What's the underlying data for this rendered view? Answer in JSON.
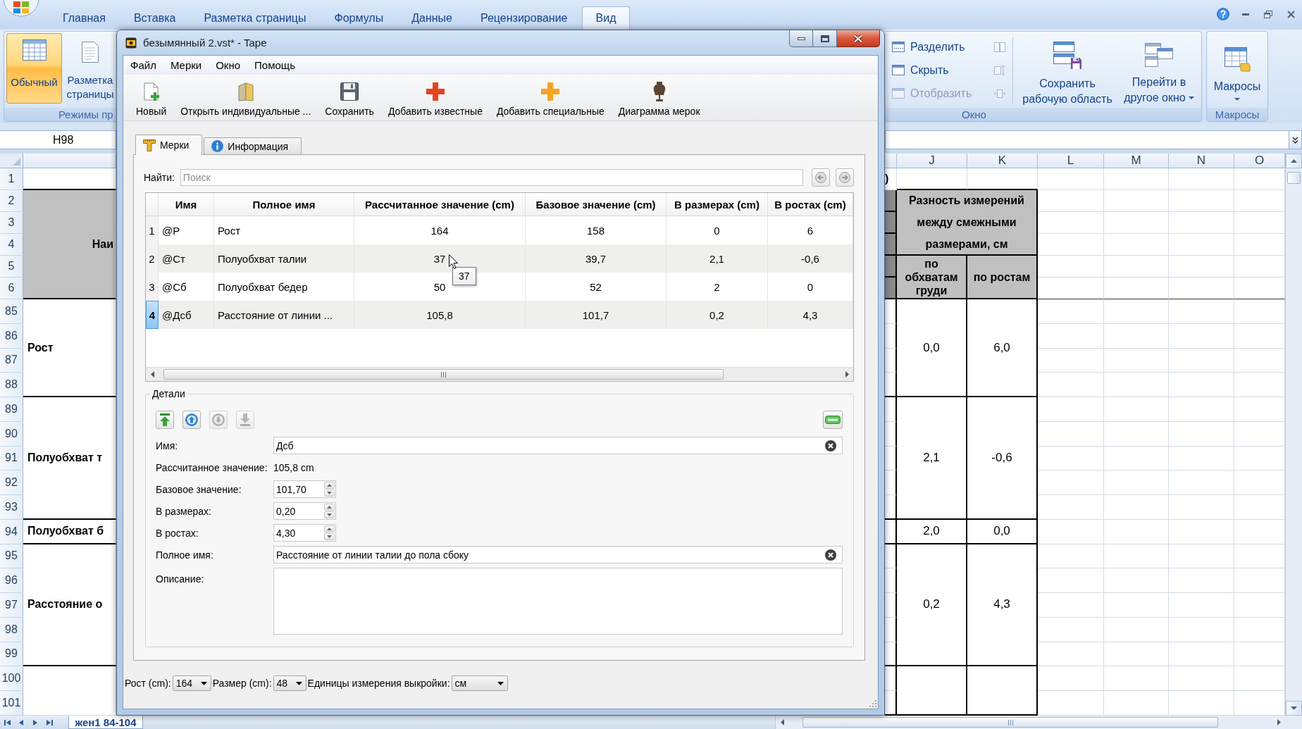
{
  "excel": {
    "ribbon_tabs": [
      {
        "label": "Главная",
        "selected": false
      },
      {
        "label": "Вставка",
        "selected": false
      },
      {
        "label": "Разметка страницы",
        "selected": false
      },
      {
        "label": "Формулы",
        "selected": false
      },
      {
        "label": "Данные",
        "selected": false
      },
      {
        "label": "Рецензирование",
        "selected": false
      },
      {
        "label": "Вид",
        "selected": true
      }
    ],
    "view_group": {
      "label": "Режимы пр",
      "buttons": [
        {
          "label": "Обычный",
          "selected": true
        },
        {
          "label": "Разметка страницы",
          "selected": false
        }
      ]
    },
    "window_group": {
      "label": "Окно",
      "commands": [
        {
          "label": "Разделить",
          "disabled": false
        },
        {
          "label": "Скрыть",
          "disabled": false
        },
        {
          "label": "Отобразить",
          "disabled": true
        }
      ],
      "small_buttons": [
        {
          "disabled": true
        },
        {
          "disabled": true
        },
        {
          "disabled": true
        }
      ],
      "large_buttons": [
        {
          "label": "Сохранить рабочую область",
          "has_menu": false
        },
        {
          "label": "Перейти в другое окно",
          "has_menu": true
        }
      ]
    },
    "macros_group": {
      "label": "Макросы",
      "button": {
        "label": "Макросы",
        "has_menu": true
      }
    },
    "name_box": "H98",
    "columns": [
      "J",
      "K",
      "L",
      "M",
      "N",
      "O"
    ],
    "header_block": {
      "rows": [
        "1",
        "2",
        "3",
        "4",
        "5",
        "6"
      ],
      "column_a": "Наи",
      "column_i": ")",
      "span_heading": "Разность измерений между смежными размерами, см",
      "column_j": "по обхватам груди",
      "column_k": "по ростам"
    },
    "blocks": [
      {
        "rows": [
          "85",
          "86",
          "87",
          "88"
        ],
        "column_a": "Рост",
        "column_j": "0,0",
        "column_k": "6,0"
      },
      {
        "rows": [
          "89",
          "90",
          "91",
          "92",
          "93"
        ],
        "column_a": "Полуобхват т",
        "column_j": "2,1",
        "column_k": "-0,6"
      },
      {
        "rows": [
          "94"
        ],
        "column_a": "Полуобхват б",
        "column_j": "2,0",
        "column_k": "0,0"
      },
      {
        "rows": [
          "95",
          "96",
          "97",
          "98",
          "99"
        ],
        "column_a": "Расстояние о",
        "column_j": "0,2",
        "column_k": "4,3"
      },
      {
        "rows": [
          "100",
          "101"
        ]
      }
    ],
    "sheet_tab": "жен1 84-104"
  },
  "dialog": {
    "title": "безымянный 2.vst* - Tape",
    "menu": [
      "Файл",
      "Мерки",
      "Окно",
      "Помощь"
    ],
    "toolbar": [
      "Новый",
      "Открыть индивидуальные ...",
      "Сохранить",
      "Добавить известные",
      "Добавить специальные",
      "Диаграмма мерок"
    ],
    "tabs": [
      {
        "label": "Мерки",
        "selected": true
      },
      {
        "label": "Информация",
        "selected": false
      }
    ],
    "search": {
      "label": "Найти:",
      "placeholder": "Поиск"
    },
    "table": {
      "columns": [
        "Имя",
        "Полное имя",
        "Рассчитанное значение (cm)",
        "Базовое значение (cm)",
        "В размерах (cm)",
        "В ростах (cm)"
      ],
      "rows": [
        {
          "number": "1",
          "cells": [
            "@Р",
            "Рост",
            "164",
            "158",
            "0",
            "6"
          ],
          "selected": false
        },
        {
          "number": "2",
          "cells": [
            "@Ст",
            "Полуобхват талии",
            "37",
            "39,7",
            "2,1",
            "-0,6"
          ],
          "selected": false
        },
        {
          "number": "3",
          "cells": [
            "@Сб",
            "Полуобхват бедер",
            "50",
            "52",
            "2",
            "0"
          ],
          "selected": false
        },
        {
          "number": "4",
          "cells": [
            "@Дсб",
            "Расстояние от линии ...",
            "105,8",
            "101,7",
            "0,2",
            "4,3"
          ],
          "selected": true
        }
      ]
    },
    "tooltip": "37",
    "details": {
      "title": "Детали",
      "move_buttons": [
        {
          "disabled": false
        },
        {
          "disabled": false
        },
        {
          "disabled": true
        },
        {
          "disabled": true
        }
      ],
      "fields": [
        {
          "kind": "text",
          "label": "Имя:",
          "value": "Дсб"
        },
        {
          "kind": "readout",
          "label": "Рассчитанное значение:",
          "value": "105,8 cm"
        },
        {
          "kind": "spin",
          "label": "Базовое значение:",
          "value": "101,70"
        },
        {
          "kind": "spin",
          "label": "В размерах:",
          "value": "0,20"
        },
        {
          "kind": "spin",
          "label": "В ростах:",
          "value": "4,30"
        },
        {
          "kind": "text",
          "label": "Полное имя:",
          "value": "Расстояние от линии талии до пола сбоку"
        },
        {
          "kind": "textarea",
          "label": "Описание:"
        }
      ]
    },
    "status_bar": [
      {
        "label": "Рост (cm):",
        "value": "164"
      },
      {
        "label": "Размер (cm):",
        "value": "48"
      },
      {
        "label": "Единицы измерения выкройки:",
        "value": "см"
      }
    ]
  }
}
